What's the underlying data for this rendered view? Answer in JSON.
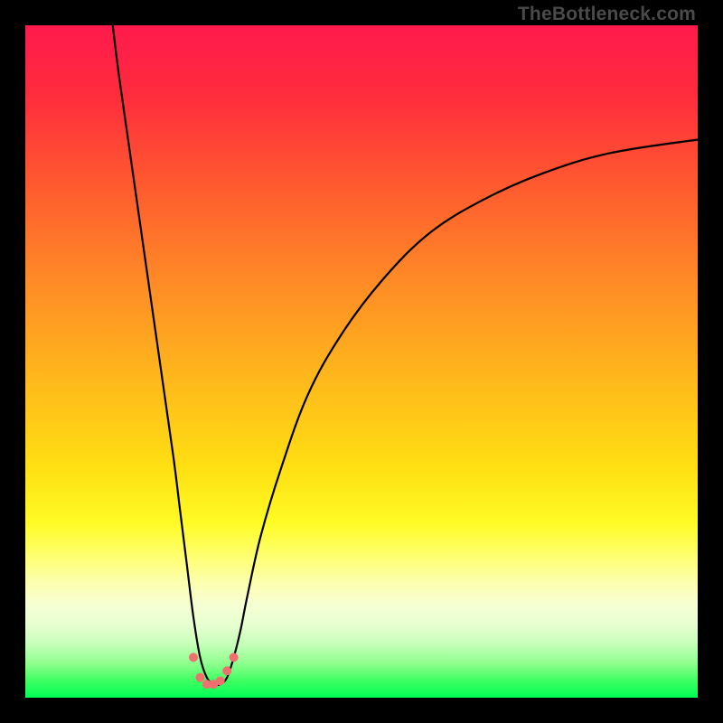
{
  "watermark": "TheBottleneck.com",
  "colors": {
    "bg_black": "#000000",
    "curve": "#000000",
    "dots": "#f07070",
    "watermark": "#4a4a4a",
    "gradient_stops": [
      {
        "offset": 0.0,
        "color": "#ff1a4d"
      },
      {
        "offset": 0.1,
        "color": "#ff2b3d"
      },
      {
        "offset": 0.25,
        "color": "#ff5e2e"
      },
      {
        "offset": 0.38,
        "color": "#ff8a26"
      },
      {
        "offset": 0.52,
        "color": "#ffb61c"
      },
      {
        "offset": 0.66,
        "color": "#ffe012"
      },
      {
        "offset": 0.74,
        "color": "#fffb25"
      },
      {
        "offset": 0.79,
        "color": "#feff70"
      },
      {
        "offset": 0.83,
        "color": "#fcffb0"
      },
      {
        "offset": 0.86,
        "color": "#f7ffd2"
      },
      {
        "offset": 0.89,
        "color": "#e8ffd0"
      },
      {
        "offset": 0.92,
        "color": "#c7ffba"
      },
      {
        "offset": 0.95,
        "color": "#8cff8c"
      },
      {
        "offset": 0.975,
        "color": "#3dff62"
      },
      {
        "offset": 1.0,
        "color": "#00ff55"
      }
    ]
  },
  "chart_data": {
    "type": "line",
    "title": "",
    "xlabel": "",
    "ylabel": "",
    "xlim": [
      0,
      100
    ],
    "ylim": [
      0,
      100
    ],
    "series": [
      {
        "name": "bottleneck-curve",
        "x": [
          13,
          14,
          16,
          18,
          20,
          22,
          23,
          24,
          25,
          26,
          27,
          28,
          29,
          30,
          31,
          32,
          33,
          35,
          38,
          42,
          47,
          53,
          60,
          68,
          77,
          87,
          100
        ],
        "y": [
          100,
          92,
          78,
          64,
          50,
          36,
          28,
          20,
          12,
          6,
          3,
          2,
          2,
          3,
          6,
          10,
          15,
          24,
          34,
          45,
          54,
          62,
          69,
          74,
          78,
          81,
          83
        ]
      }
    ],
    "dots": {
      "name": "minimum-markers",
      "x": [
        25,
        26,
        27,
        28,
        29,
        30,
        31
      ],
      "y": [
        6,
        3,
        2,
        2,
        2.5,
        4,
        6
      ],
      "r": 5
    }
  }
}
